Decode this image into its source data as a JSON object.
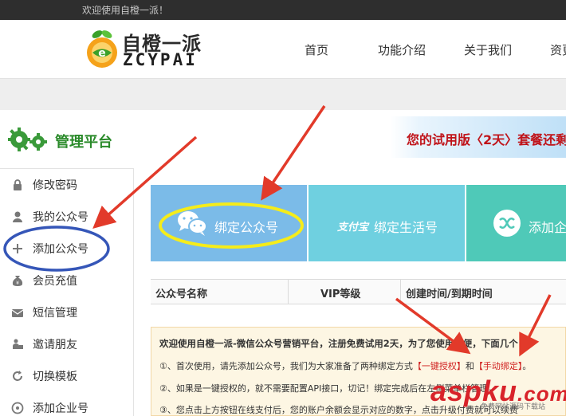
{
  "topbar": {
    "welcome": "欢迎使用自橙一派！"
  },
  "logo": {
    "cn": "自橙一派",
    "en": "ZCYPAI"
  },
  "nav": [
    {
      "label": "首页"
    },
    {
      "label": "功能介绍"
    },
    {
      "label": "关于我们"
    },
    {
      "label": "资更"
    }
  ],
  "panel": {
    "title": "管理平台",
    "trial": "您的试用版〈2天〉套餐还剩"
  },
  "sidebar": {
    "items": [
      {
        "label": "修改密码",
        "icon": "lock-icon"
      },
      {
        "label": "我的公众号",
        "icon": "user-icon"
      },
      {
        "label": "添加公众号",
        "icon": "plus-icon"
      },
      {
        "label": "会员充值",
        "icon": "money-bag-icon"
      },
      {
        "label": "短信管理",
        "icon": "envelope-icon"
      },
      {
        "label": "邀请朋友",
        "icon": "invite-icon"
      },
      {
        "label": "切换模板",
        "icon": "refresh-icon"
      },
      {
        "label": "添加企业号",
        "icon": "enterprise-icon"
      }
    ]
  },
  "tiles": [
    {
      "label": "绑定公众号",
      "icon": "wechat-icon",
      "color": "#7bbbe8"
    },
    {
      "label": "绑定生活号",
      "icon": "alipay-icon",
      "brand": "支付宝",
      "color": "#6fd0e0"
    },
    {
      "label": "添加企",
      "icon": "exchange-icon",
      "color": "#4fc9b8"
    }
  ],
  "table": {
    "columns": [
      "公众号名称",
      "VIP等级",
      "创建时间/到期时间"
    ]
  },
  "notice": {
    "line1": "欢迎使用自橙一派-微信公众号营销平台，注册免费试用2天，为了您使用方便，下面几个",
    "line2_a": "①、首次使用，请先添加公众号，我们为大家准备了两种绑定方式",
    "line2_b": "【一键授权】",
    "line2_c": "和",
    "line2_d": "【手动绑定】",
    "line2_e": "。",
    "line3": "②、如果是一键授权的，就不需要配置API接口，切记！绑定完成后在左侧菜单栏管理，",
    "line4": "③、您点击上方按钮在线支付后，您的账户余额会显示对应的数字，点击升级付费就可以续费"
  },
  "watermark": {
    "main": "aspku",
    "tld": ".com",
    "sub": "免费网站源码下载站"
  },
  "colors": {
    "annotation_red": "#e23a2a",
    "highlight_yellow": "#f5ec1a",
    "circle_blue": "#3556b8"
  }
}
